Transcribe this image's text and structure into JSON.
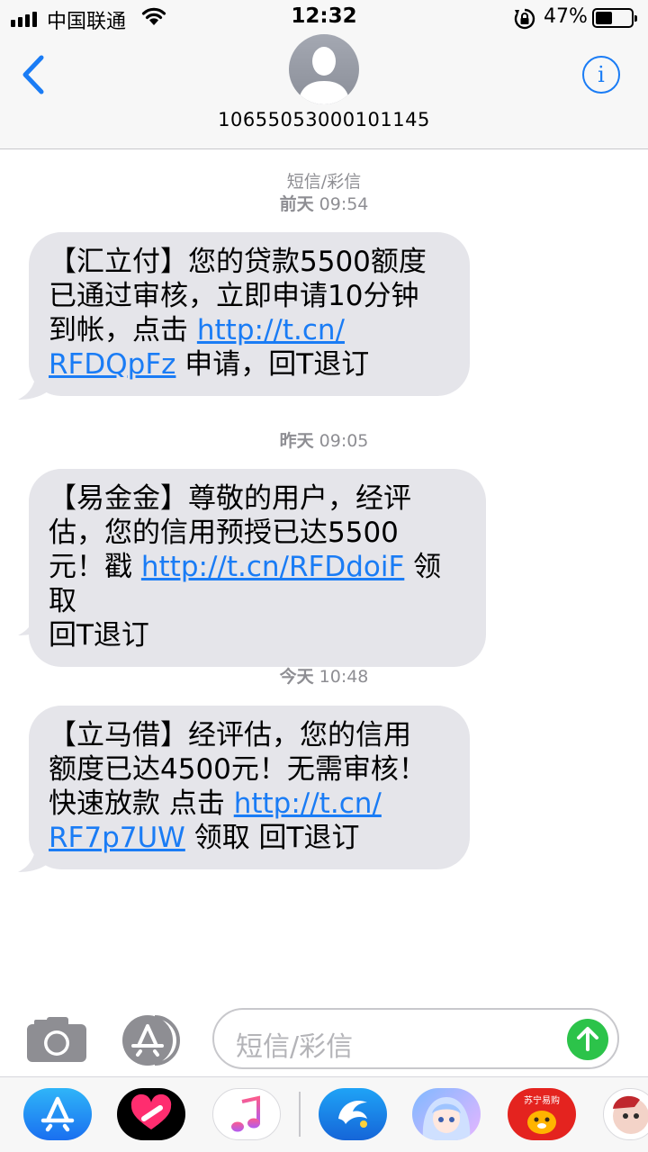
{
  "status_bar": {
    "carrier": "中国联通",
    "time": "12:32",
    "battery_percent": "47%",
    "battery_level": 0.47,
    "icons": [
      "signal-icon",
      "wifi-icon",
      "rotation-lock-icon",
      "battery-icon"
    ]
  },
  "header": {
    "contact_number": "10655053000101145",
    "back_icon": "chevron-left-icon",
    "info_icon": "info-icon",
    "info_glyph": "i",
    "accent_color": "#1a7cf5"
  },
  "conversation": {
    "type_label": "短信/彩信",
    "messages": [
      {
        "day": "前天",
        "time": "09:54",
        "lines": [
          {
            "text": "【汇立付】您的贷款5500额度"
          },
          {
            "text": "已通过审核，立即申请10分钟"
          },
          {
            "text": "到帐，点击 ",
            "link": "http://t.cn/"
          },
          {
            "link": "RFDQpFz",
            "after": " 申请，回T退订"
          }
        ]
      },
      {
        "day": "昨天",
        "time": "09:05",
        "lines": [
          {
            "text": "【易金金】尊敬的用户，经评"
          },
          {
            "text": "估，您的信用预授已达5500"
          },
          {
            "text": "元！戳 ",
            "link": "http://t.cn/RFDdoiF",
            "after": " 领取"
          },
          {
            "text": "回T退订"
          }
        ]
      },
      {
        "day": "今天",
        "time": "10:48",
        "lines": [
          {
            "text": "【立马借】经评估，您的信用"
          },
          {
            "text": "额度已达4500元！无需审核！"
          },
          {
            "text": "快速放款 点击 ",
            "link": "http://t.cn/"
          },
          {
            "link": "RF7p7UW",
            "after": " 领取 回T退订"
          }
        ]
      }
    ],
    "bubble_color": "#e5e5ea"
  },
  "input_bar": {
    "placeholder": "短信/彩信",
    "camera_icon": "camera-icon",
    "apps_icon": "app-store-icon",
    "send_icon": "send-arrow-icon",
    "send_color": "#2cc34a"
  },
  "app_drawer": {
    "apps": [
      {
        "name": "app-store-app",
        "icon": "app-store-icon"
      },
      {
        "name": "digital-touch-app",
        "icon": "heart-icon"
      },
      {
        "name": "music-app",
        "icon": "music-note-icon"
      },
      {
        "name": "dolphin-app",
        "icon": "dolphin-icon"
      },
      {
        "name": "game-app",
        "icon": "anime-character-icon"
      },
      {
        "name": "suning-app",
        "icon": "suning-logo-icon",
        "logo_text": "苏宁易购"
      },
      {
        "name": "sticker-app",
        "icon": "sticker-icon"
      }
    ]
  }
}
